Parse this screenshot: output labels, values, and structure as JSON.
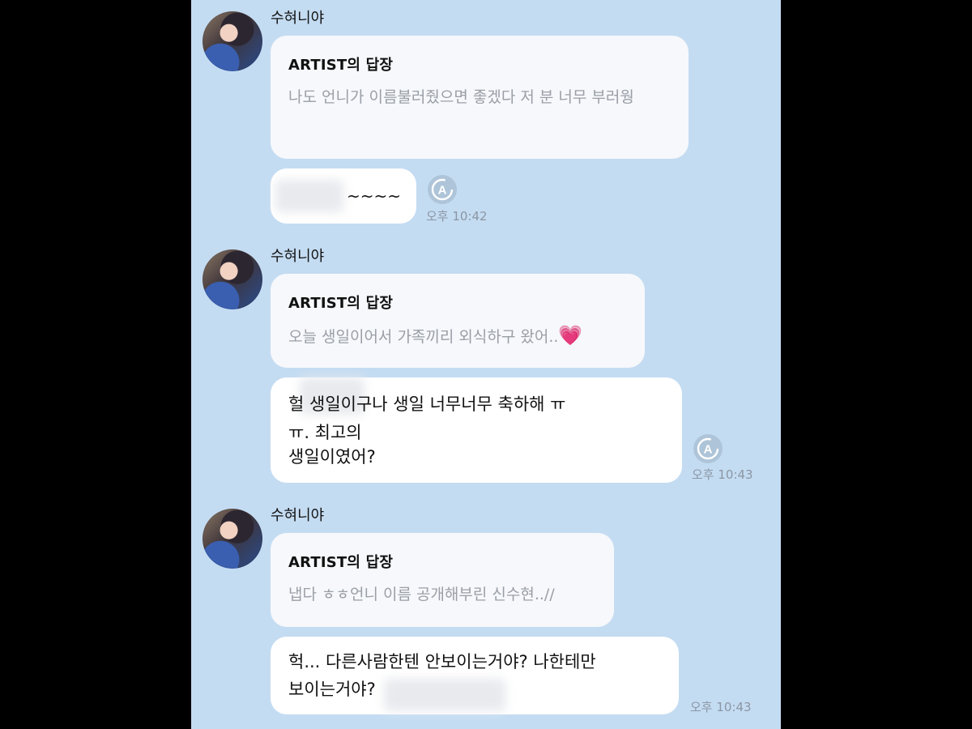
{
  "sender_name": "수혀니야",
  "reply_header": "ARTIST의 답장",
  "messages": [
    {
      "reply_text": "나도 언니가 이름불러줬으면 좋겠다 저 분 너무 부러웡",
      "user_text": "~~~~",
      "time": "오후 10:42"
    },
    {
      "reply_text": "오늘 생일이어서 가족끼리 외식하구 왔어..",
      "reply_emoji": "💗",
      "user_text_line1": "헐        생일이구나 생일 너무너무 축하해 ㅠ",
      "user_text_line2": "ㅠ.  최고의",
      "user_text_line3": "생일이였어?",
      "time": "오후 10:43"
    },
    {
      "reply_text": "냅다 ㅎㅎ언니 이름 공개해부린 신수현..//",
      "user_text_line1": "헉... 다른사람한텐 안보이는거야? 나한테만",
      "user_text_line2": "보이는거야?",
      "time": "오후 10:43"
    }
  ],
  "icons": {
    "reaction": "reaction-icon",
    "avatar": "avatar"
  },
  "colors": {
    "background": "#c4dcf2",
    "reply_bubble": "#f6f8fb",
    "bubble": "#ffffff",
    "heart": "#ef6cc0"
  }
}
